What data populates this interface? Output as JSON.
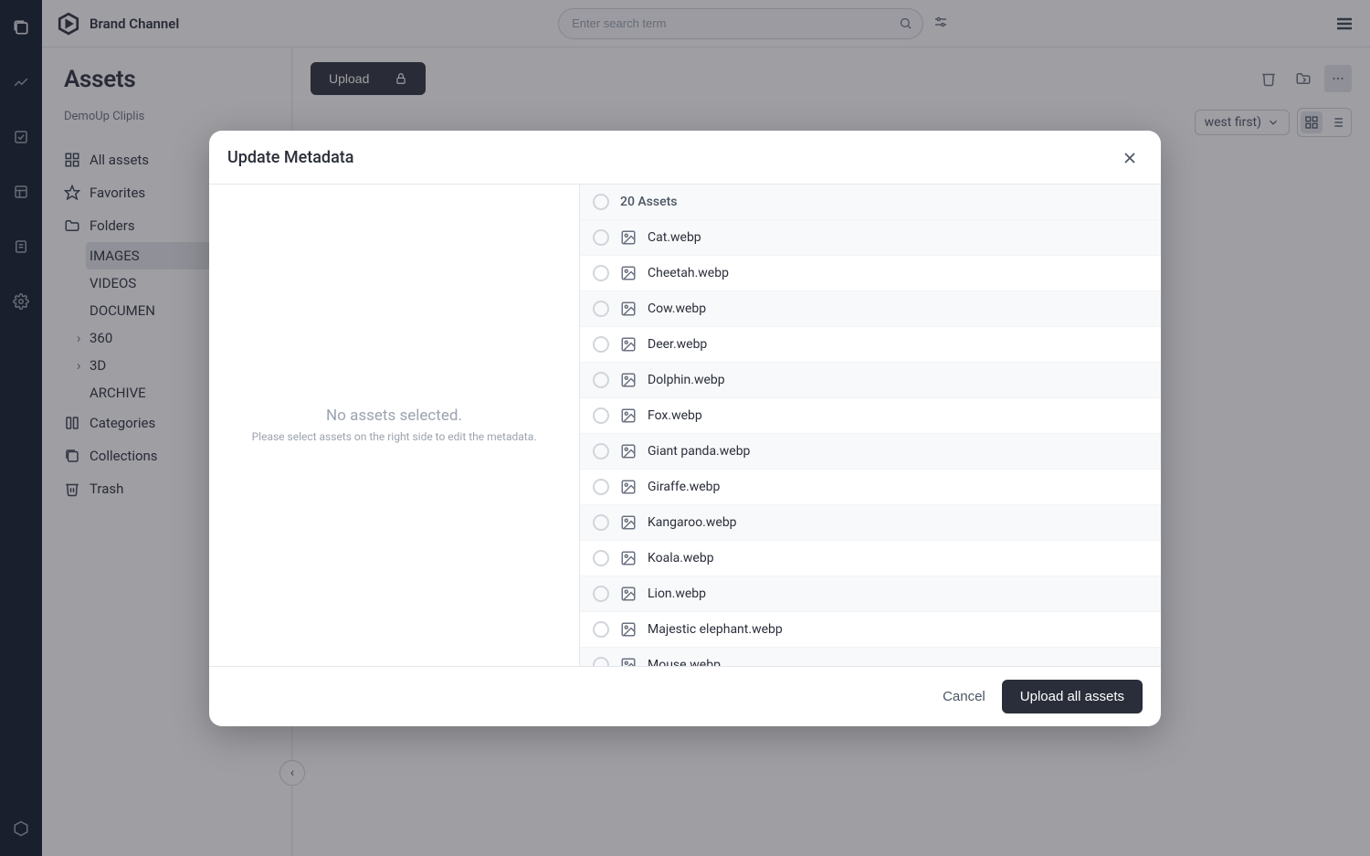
{
  "header": {
    "brand": "Brand Channel",
    "search_placeholder": "Enter search term"
  },
  "sidebar": {
    "title": "Assets",
    "breadcrumb": "DemoUp Cliplis",
    "nav": {
      "all_assets": "All assets",
      "favorites": "Favorites",
      "folders": "Folders",
      "categories": "Categories",
      "collections": "Collections",
      "trash": "Trash"
    },
    "folders": [
      "IMAGES",
      "VIDEOS",
      "DOCUMEN",
      "360",
      "3D",
      "ARCHIVE"
    ]
  },
  "toolbar": {
    "upload_label": "Upload",
    "sort_label": "west first)"
  },
  "modal": {
    "title": "Update Metadata",
    "empty_title": "No assets selected.",
    "empty_sub": "Please select assets on the right side to edit the metadata.",
    "count_label": "20 Assets",
    "assets": [
      "Cat.webp",
      "Cheetah.webp",
      "Cow.webp",
      "Deer.webp",
      "Dolphin.webp",
      "Fox.webp",
      "Giant panda.webp",
      "Giraffe.webp",
      "Kangaroo.webp",
      "Koala.webp",
      "Lion.webp",
      "Majestic elephant.webp",
      "Mouse.webp"
    ],
    "cancel": "Cancel",
    "upload_all": "Upload all assets"
  }
}
